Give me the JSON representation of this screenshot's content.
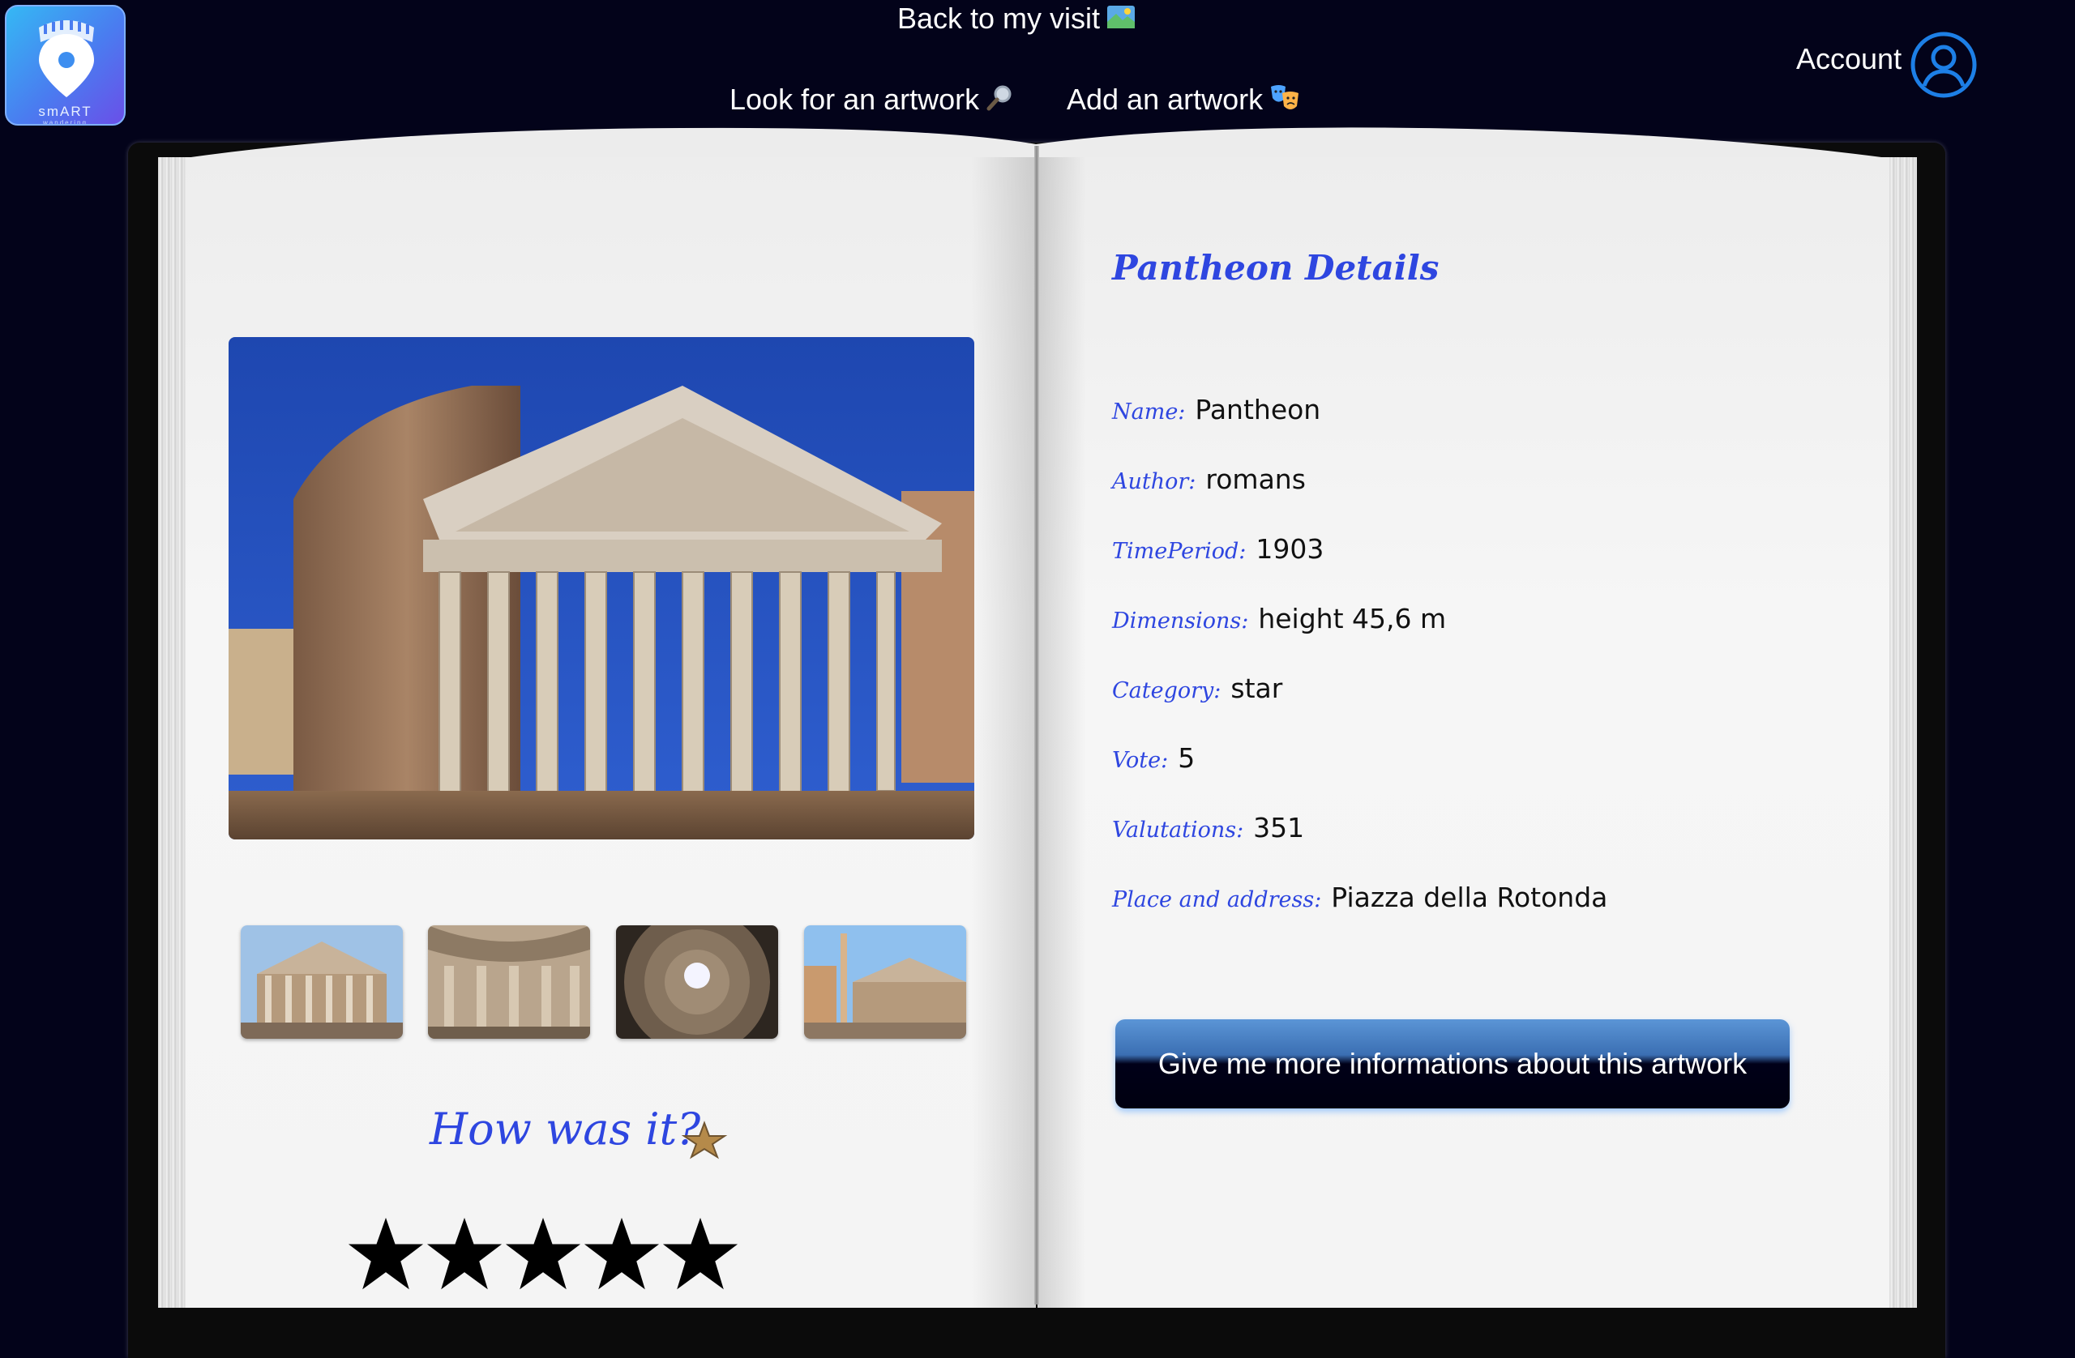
{
  "logo": {
    "text": "smART",
    "subtext": "wandering"
  },
  "nav": {
    "back_label": "Back to my visit",
    "back_icon": "map-icon",
    "look_label": "Look for an artwork",
    "look_icon": "magnifier-icon",
    "add_label": "Add an artwork",
    "add_icon": "theater-masks-icon",
    "account_label": "Account",
    "account_icon": "user-circle-icon"
  },
  "left_page": {
    "main_image": "pantheon-facade-photo",
    "thumbnails": [
      "pantheon-front-thumbnail",
      "pantheon-interior-thumbnail",
      "pantheon-dome-oculus-thumbnail",
      "pantheon-piazza-obelisk-thumbnail"
    ],
    "rating_prompt": "How was it?",
    "rating_value": 0,
    "rating_max": 5
  },
  "right_page": {
    "title": "Pantheon Details",
    "details": [
      {
        "key": "Name:",
        "value": "Pantheon"
      },
      {
        "key": "Author:",
        "value": "romans"
      },
      {
        "key": "TimePeriod:",
        "value": "1903"
      },
      {
        "key": "Dimensions:",
        "value": "height 45,6 m"
      },
      {
        "key": "Category:",
        "value": "star"
      },
      {
        "key": "Vote:",
        "value": "5"
      },
      {
        "key": "Valutations:",
        "value": "351"
      },
      {
        "key": "Place and address:",
        "value": "Piazza della Rotonda"
      }
    ],
    "more_button": "Give me more informations about this artwork"
  },
  "colors": {
    "background": "#03031a",
    "accent_blue": "#2e46e0",
    "button_dark": "#000018",
    "account_icon": "#1d7fe6"
  }
}
